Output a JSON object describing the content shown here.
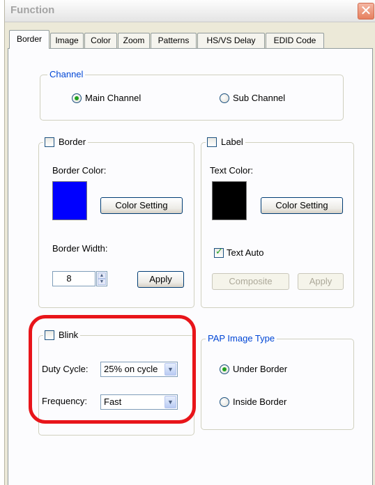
{
  "window": {
    "title": "Function",
    "close_glyph": "✕"
  },
  "tabs": [
    "Border",
    "Image",
    "Color",
    "Zoom",
    "Patterns",
    "HS/VS Delay",
    "EDID Code"
  ],
  "active_tab": "Border",
  "channel": {
    "legend": "Channel",
    "main_label": "Main Channel",
    "sub_label": "Sub Channel",
    "selected": "Main Channel"
  },
  "border_group": {
    "legend": "Border",
    "checked": false,
    "color_label": "Border Color:",
    "color": "#0000ff",
    "color_button": "Color Setting",
    "width_label": "Border Width:",
    "width_value": "8",
    "apply_button": "Apply"
  },
  "label_group": {
    "legend": "Label",
    "checked": false,
    "color_label": "Text Color:",
    "color": "#000000",
    "color_button": "Color Setting",
    "text_auto_label": "Text Auto",
    "text_auto_checked": true,
    "composite_button": "Composite",
    "apply_button": "Apply"
  },
  "blink_group": {
    "legend": "Blink",
    "checked": false,
    "duty_label": "Duty Cycle:",
    "duty_value": "25% on cycle",
    "freq_label": "Frequency:",
    "freq_value": "Fast"
  },
  "pap_group": {
    "legend": "PAP Image Type",
    "under_label": "Under Border",
    "inside_label": "Inside Border",
    "selected": "Under Border"
  },
  "colors": {
    "highlight": "#e8151a",
    "legend_blue": "#0046d5",
    "radio_dot": "#21a121"
  }
}
